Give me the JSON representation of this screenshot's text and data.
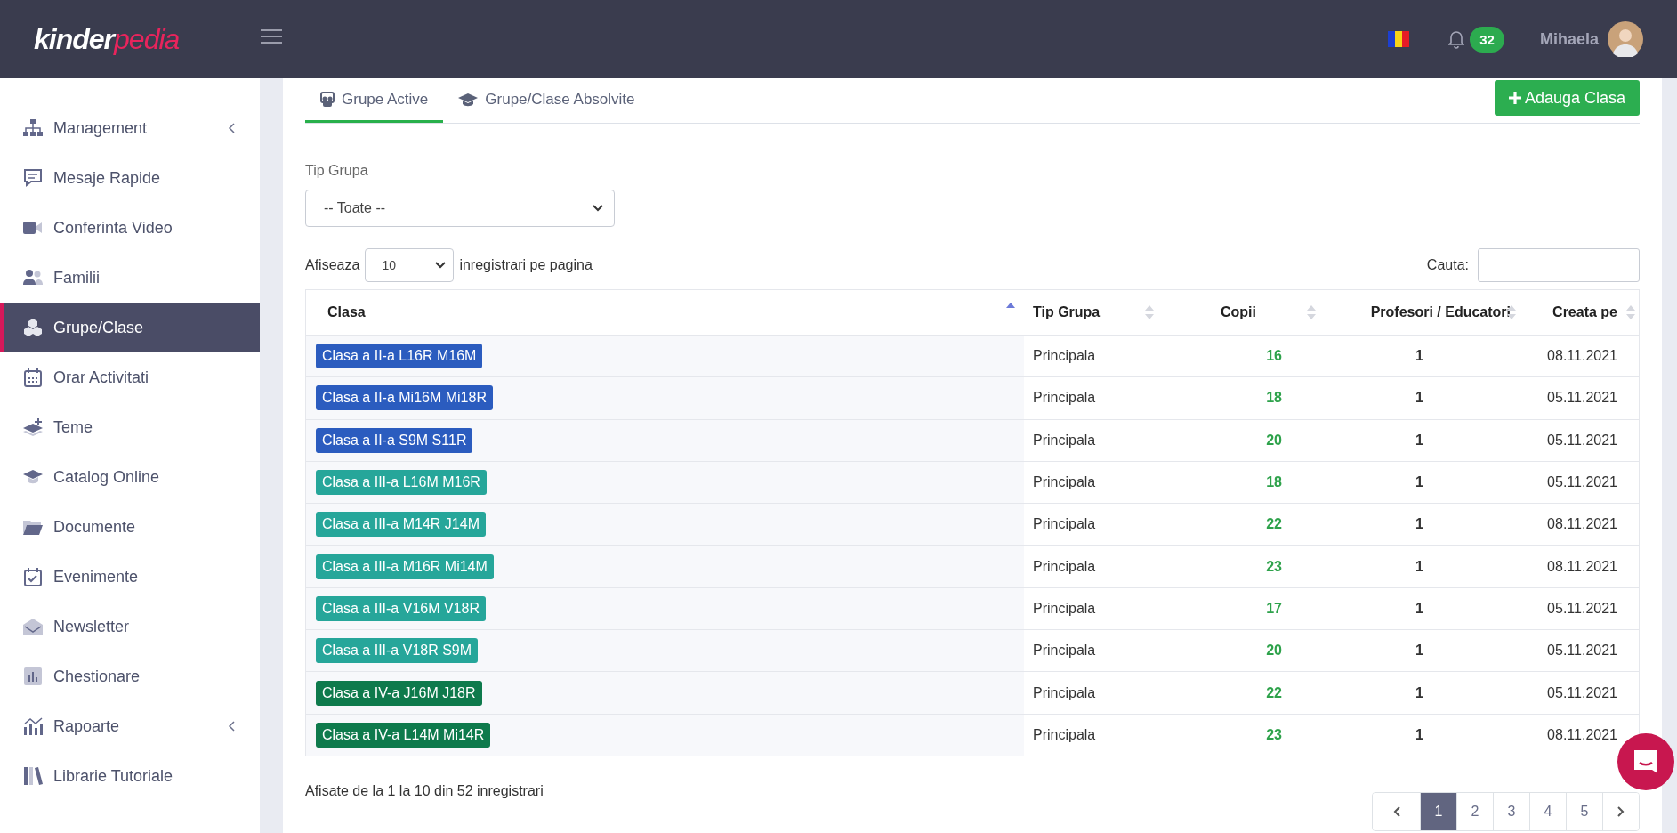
{
  "brand": {
    "part1": "kinder",
    "part2": "pedia"
  },
  "notifications": {
    "count": "32"
  },
  "user": {
    "name": "Mihaela"
  },
  "sidebar": {
    "items": [
      {
        "label": "Management",
        "selected": false,
        "submenu": true
      },
      {
        "label": "Mesaje Rapide",
        "selected": false,
        "submenu": false
      },
      {
        "label": "Conferinta Video",
        "selected": false,
        "submenu": false
      },
      {
        "label": "Familii",
        "selected": false,
        "submenu": false
      },
      {
        "label": "Grupe/Clase",
        "selected": true,
        "submenu": false
      },
      {
        "label": "Orar Activitati",
        "selected": false,
        "submenu": false
      },
      {
        "label": "Teme",
        "selected": false,
        "submenu": false
      },
      {
        "label": "Catalog Online",
        "selected": false,
        "submenu": false
      },
      {
        "label": "Documente",
        "selected": false,
        "submenu": false
      },
      {
        "label": "Evenimente",
        "selected": false,
        "submenu": false
      },
      {
        "label": "Newsletter",
        "selected": false,
        "submenu": false
      },
      {
        "label": "Chestionare",
        "selected": false,
        "submenu": false
      },
      {
        "label": "Rapoarte",
        "selected": false,
        "submenu": true
      },
      {
        "label": "Librarie Tutoriale",
        "selected": false,
        "submenu": false
      }
    ]
  },
  "tabs": [
    {
      "label": "Grupe Active",
      "selected": true
    },
    {
      "label": "Grupe/Clase Absolvite",
      "selected": false
    }
  ],
  "add_button": "Adauga Clasa",
  "filter": {
    "label": "Tip Grupa",
    "value": "-- Toate --"
  },
  "length": {
    "prefix": "Afiseaza",
    "value": "10",
    "suffix": "inregistrari pe pagina"
  },
  "search": {
    "label": "Cauta:"
  },
  "table": {
    "columns": [
      {
        "label": "Clasa",
        "sorted": true
      },
      {
        "label": "Tip Grupa",
        "sorted": false
      },
      {
        "label": "Copii",
        "sorted": false
      },
      {
        "label": "Profesori / Educatori",
        "sorted": false
      },
      {
        "label": "Creata pe",
        "sorted": false
      }
    ],
    "rows": [
      {
        "clasa": "Clasa a II-a L16R M16M",
        "color": "#2b5cbf",
        "tip": "Principala",
        "copii": "16",
        "profesori": "1",
        "creata": "08.11.2021"
      },
      {
        "clasa": "Clasa a II-a Mi16M Mi18R",
        "color": "#2b5cbf",
        "tip": "Principala",
        "copii": "18",
        "profesori": "1",
        "creata": "05.11.2021"
      },
      {
        "clasa": "Clasa a II-a S9M S11R",
        "color": "#2b5cbf",
        "tip": "Principala",
        "copii": "20",
        "profesori": "1",
        "creata": "05.11.2021"
      },
      {
        "clasa": "Clasa a III-a L16M M16R",
        "color": "#26a69a",
        "tip": "Principala",
        "copii": "18",
        "profesori": "1",
        "creata": "05.11.2021"
      },
      {
        "clasa": "Clasa a III-a M14R J14M",
        "color": "#26a69a",
        "tip": "Principala",
        "copii": "22",
        "profesori": "1",
        "creata": "08.11.2021"
      },
      {
        "clasa": "Clasa a III-a M16R Mi14M",
        "color": "#26a69a",
        "tip": "Principala",
        "copii": "23",
        "profesori": "1",
        "creata": "08.11.2021"
      },
      {
        "clasa": "Clasa a III-a V16M V18R",
        "color": "#26a69a",
        "tip": "Principala",
        "copii": "17",
        "profesori": "1",
        "creata": "05.11.2021"
      },
      {
        "clasa": "Clasa a III-a V18R S9M",
        "color": "#26a69a",
        "tip": "Principala",
        "copii": "20",
        "profesori": "1",
        "creata": "05.11.2021"
      },
      {
        "clasa": "Clasa a IV-a J16M J18R",
        "color": "#0e7a4c",
        "tip": "Principala",
        "copii": "22",
        "profesori": "1",
        "creata": "05.11.2021"
      },
      {
        "clasa": "Clasa a IV-a L14M Mi14R",
        "color": "#0e7a4c",
        "tip": "Principala",
        "copii": "23",
        "profesori": "1",
        "creata": "08.11.2021"
      }
    ]
  },
  "info": "Afisate de la 1 la 10 din 52 inregistrari",
  "pagination": [
    {
      "label": "1",
      "selected": true
    },
    {
      "label": "2",
      "selected": false
    },
    {
      "label": "3",
      "selected": false
    },
    {
      "label": "4",
      "selected": false
    },
    {
      "label": "5",
      "selected": false
    }
  ]
}
